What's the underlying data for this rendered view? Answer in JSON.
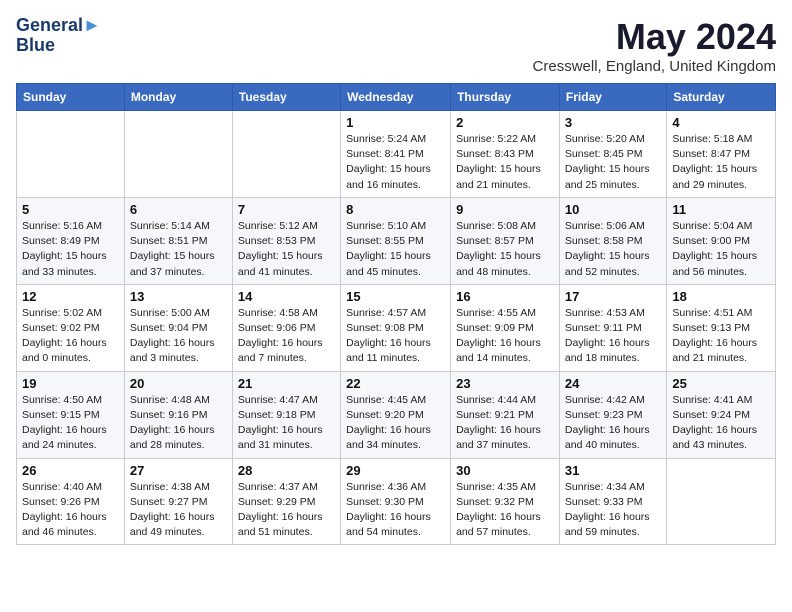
{
  "header": {
    "logo_line1": "General",
    "logo_line2": "Blue",
    "title": "May 2024",
    "subtitle": "Cresswell, England, United Kingdom"
  },
  "days_of_week": [
    "Sunday",
    "Monday",
    "Tuesday",
    "Wednesday",
    "Thursday",
    "Friday",
    "Saturday"
  ],
  "weeks": [
    [
      {
        "day": "",
        "info": ""
      },
      {
        "day": "",
        "info": ""
      },
      {
        "day": "",
        "info": ""
      },
      {
        "day": "1",
        "info": "Sunrise: 5:24 AM\nSunset: 8:41 PM\nDaylight: 15 hours\nand 16 minutes."
      },
      {
        "day": "2",
        "info": "Sunrise: 5:22 AM\nSunset: 8:43 PM\nDaylight: 15 hours\nand 21 minutes."
      },
      {
        "day": "3",
        "info": "Sunrise: 5:20 AM\nSunset: 8:45 PM\nDaylight: 15 hours\nand 25 minutes."
      },
      {
        "day": "4",
        "info": "Sunrise: 5:18 AM\nSunset: 8:47 PM\nDaylight: 15 hours\nand 29 minutes."
      }
    ],
    [
      {
        "day": "5",
        "info": "Sunrise: 5:16 AM\nSunset: 8:49 PM\nDaylight: 15 hours\nand 33 minutes."
      },
      {
        "day": "6",
        "info": "Sunrise: 5:14 AM\nSunset: 8:51 PM\nDaylight: 15 hours\nand 37 minutes."
      },
      {
        "day": "7",
        "info": "Sunrise: 5:12 AM\nSunset: 8:53 PM\nDaylight: 15 hours\nand 41 minutes."
      },
      {
        "day": "8",
        "info": "Sunrise: 5:10 AM\nSunset: 8:55 PM\nDaylight: 15 hours\nand 45 minutes."
      },
      {
        "day": "9",
        "info": "Sunrise: 5:08 AM\nSunset: 8:57 PM\nDaylight: 15 hours\nand 48 minutes."
      },
      {
        "day": "10",
        "info": "Sunrise: 5:06 AM\nSunset: 8:58 PM\nDaylight: 15 hours\nand 52 minutes."
      },
      {
        "day": "11",
        "info": "Sunrise: 5:04 AM\nSunset: 9:00 PM\nDaylight: 15 hours\nand 56 minutes."
      }
    ],
    [
      {
        "day": "12",
        "info": "Sunrise: 5:02 AM\nSunset: 9:02 PM\nDaylight: 16 hours\nand 0 minutes."
      },
      {
        "day": "13",
        "info": "Sunrise: 5:00 AM\nSunset: 9:04 PM\nDaylight: 16 hours\nand 3 minutes."
      },
      {
        "day": "14",
        "info": "Sunrise: 4:58 AM\nSunset: 9:06 PM\nDaylight: 16 hours\nand 7 minutes."
      },
      {
        "day": "15",
        "info": "Sunrise: 4:57 AM\nSunset: 9:08 PM\nDaylight: 16 hours\nand 11 minutes."
      },
      {
        "day": "16",
        "info": "Sunrise: 4:55 AM\nSunset: 9:09 PM\nDaylight: 16 hours\nand 14 minutes."
      },
      {
        "day": "17",
        "info": "Sunrise: 4:53 AM\nSunset: 9:11 PM\nDaylight: 16 hours\nand 18 minutes."
      },
      {
        "day": "18",
        "info": "Sunrise: 4:51 AM\nSunset: 9:13 PM\nDaylight: 16 hours\nand 21 minutes."
      }
    ],
    [
      {
        "day": "19",
        "info": "Sunrise: 4:50 AM\nSunset: 9:15 PM\nDaylight: 16 hours\nand 24 minutes."
      },
      {
        "day": "20",
        "info": "Sunrise: 4:48 AM\nSunset: 9:16 PM\nDaylight: 16 hours\nand 28 minutes."
      },
      {
        "day": "21",
        "info": "Sunrise: 4:47 AM\nSunset: 9:18 PM\nDaylight: 16 hours\nand 31 minutes."
      },
      {
        "day": "22",
        "info": "Sunrise: 4:45 AM\nSunset: 9:20 PM\nDaylight: 16 hours\nand 34 minutes."
      },
      {
        "day": "23",
        "info": "Sunrise: 4:44 AM\nSunset: 9:21 PM\nDaylight: 16 hours\nand 37 minutes."
      },
      {
        "day": "24",
        "info": "Sunrise: 4:42 AM\nSunset: 9:23 PM\nDaylight: 16 hours\nand 40 minutes."
      },
      {
        "day": "25",
        "info": "Sunrise: 4:41 AM\nSunset: 9:24 PM\nDaylight: 16 hours\nand 43 minutes."
      }
    ],
    [
      {
        "day": "26",
        "info": "Sunrise: 4:40 AM\nSunset: 9:26 PM\nDaylight: 16 hours\nand 46 minutes."
      },
      {
        "day": "27",
        "info": "Sunrise: 4:38 AM\nSunset: 9:27 PM\nDaylight: 16 hours\nand 49 minutes."
      },
      {
        "day": "28",
        "info": "Sunrise: 4:37 AM\nSunset: 9:29 PM\nDaylight: 16 hours\nand 51 minutes."
      },
      {
        "day": "29",
        "info": "Sunrise: 4:36 AM\nSunset: 9:30 PM\nDaylight: 16 hours\nand 54 minutes."
      },
      {
        "day": "30",
        "info": "Sunrise: 4:35 AM\nSunset: 9:32 PM\nDaylight: 16 hours\nand 57 minutes."
      },
      {
        "day": "31",
        "info": "Sunrise: 4:34 AM\nSunset: 9:33 PM\nDaylight: 16 hours\nand 59 minutes."
      },
      {
        "day": "",
        "info": ""
      }
    ]
  ]
}
